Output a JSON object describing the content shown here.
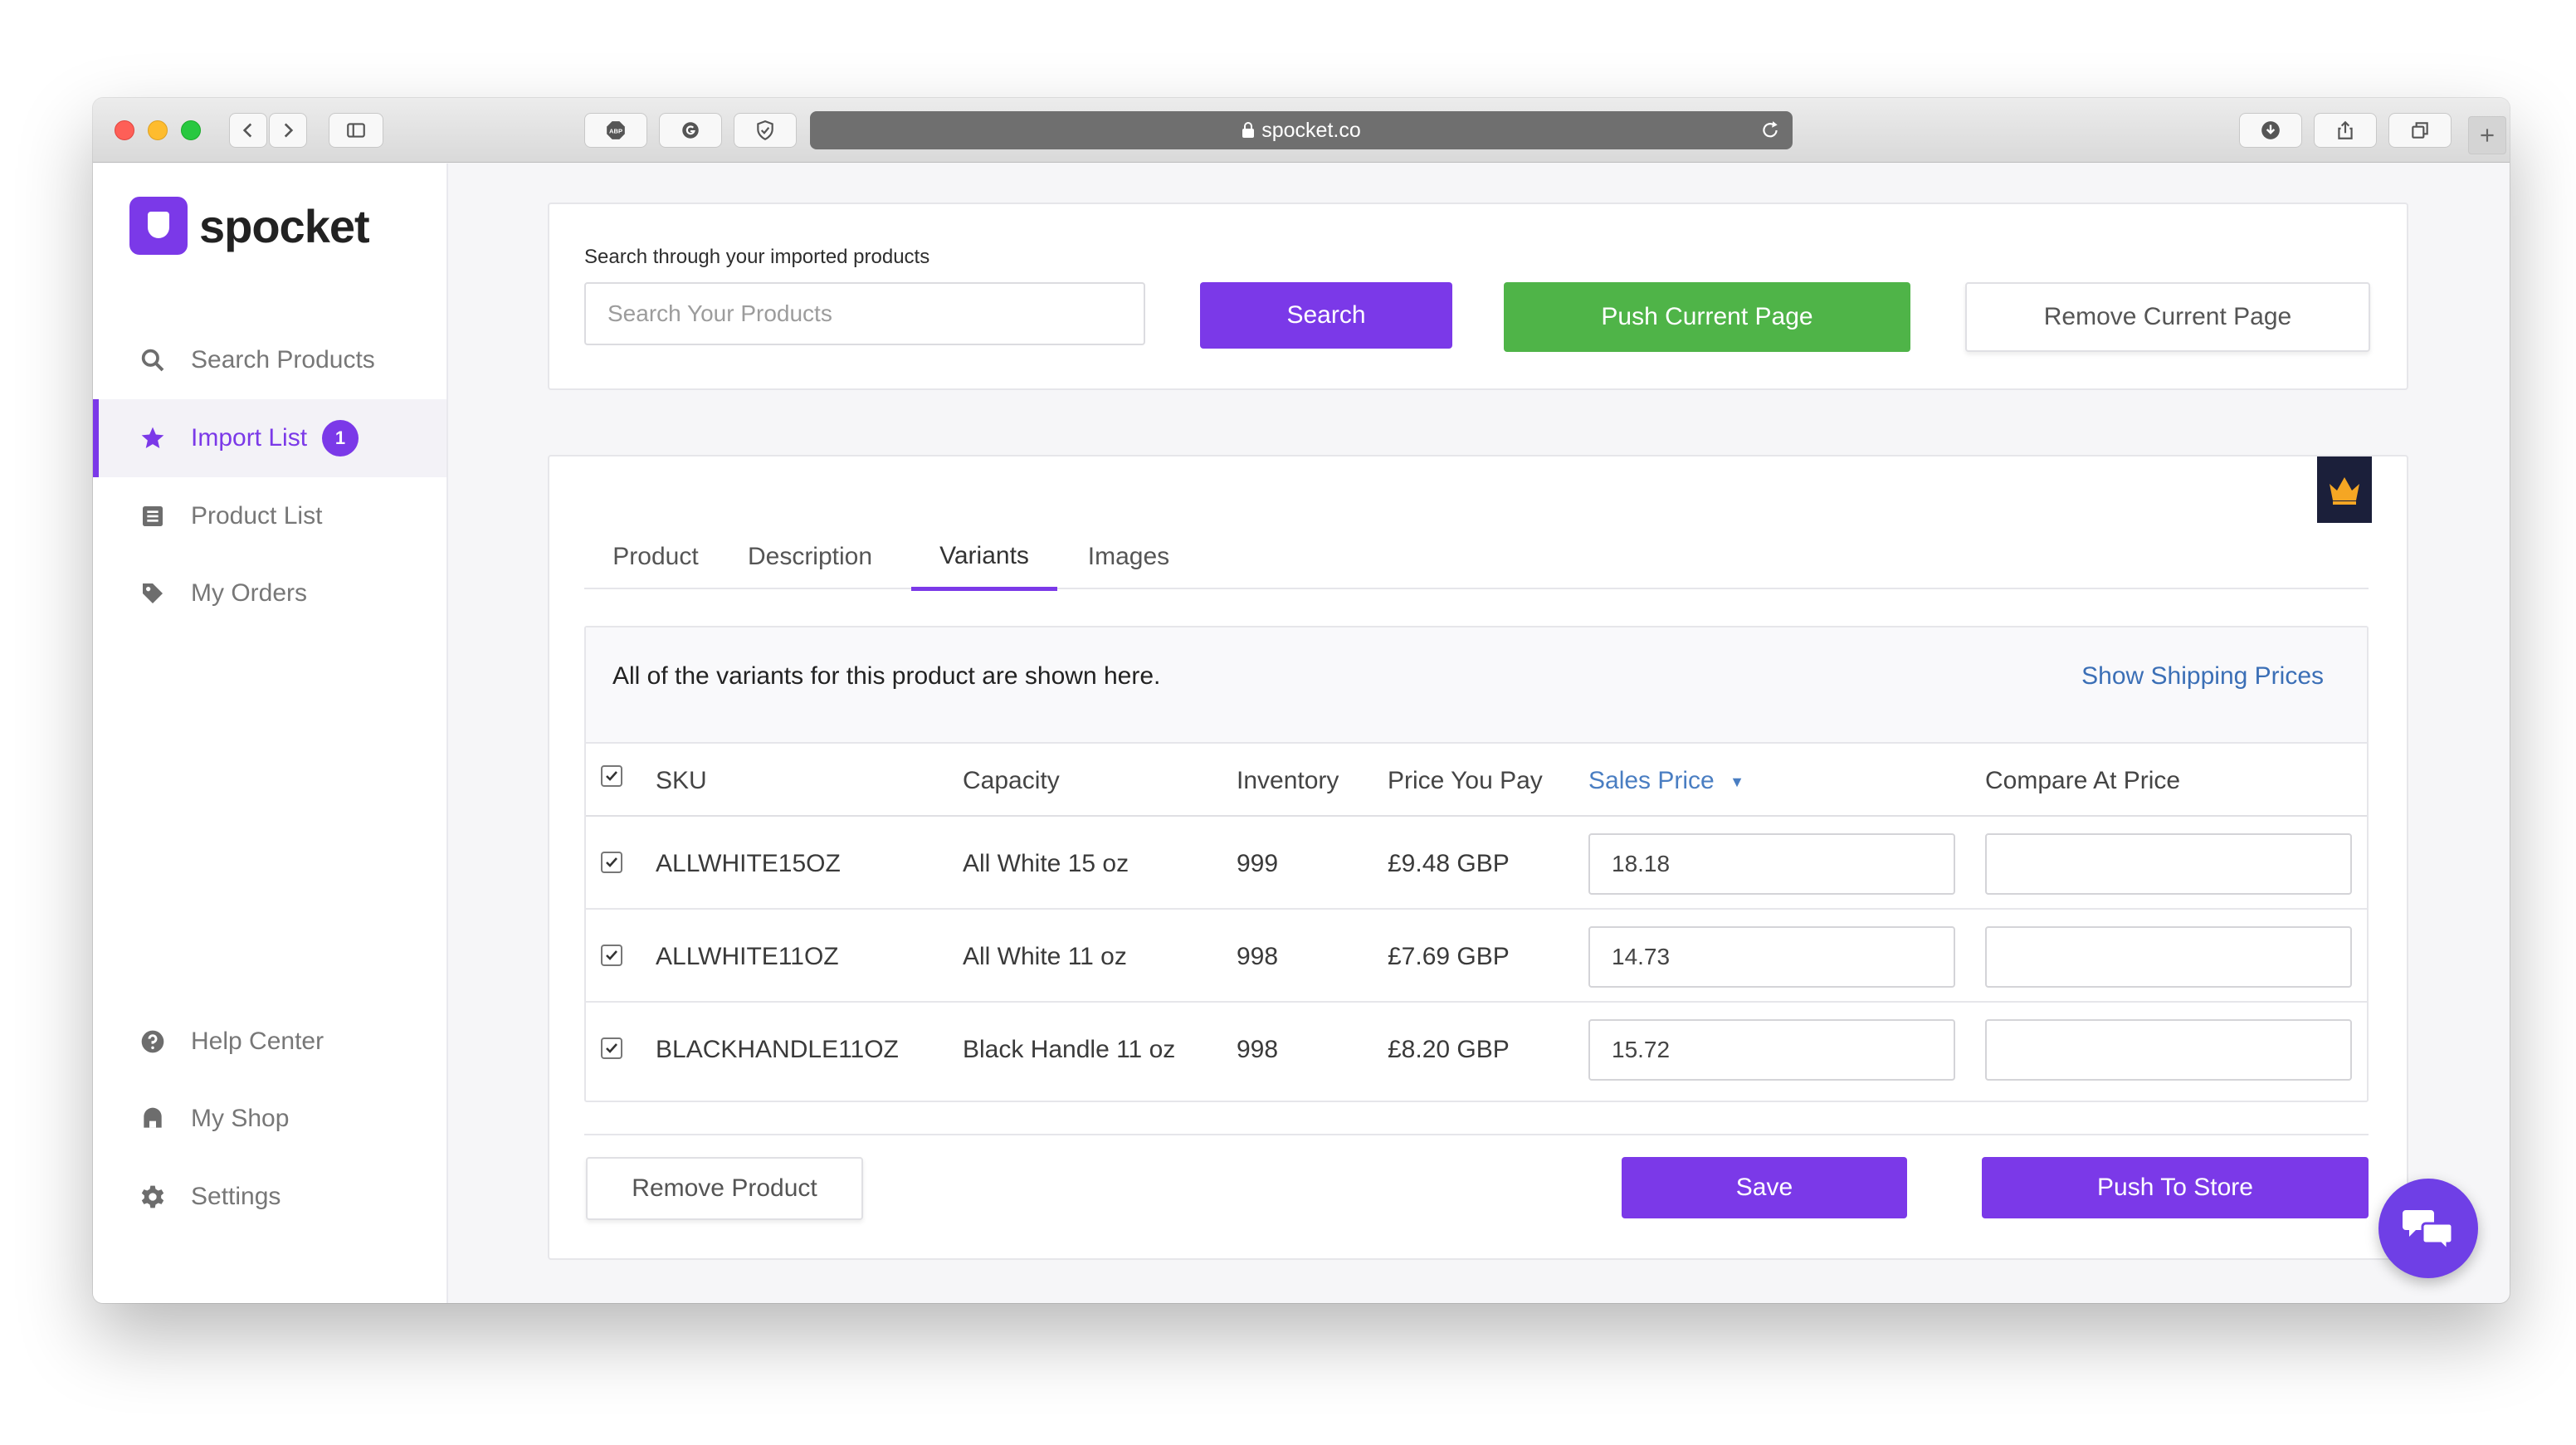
{
  "browser": {
    "url": "spocket.co",
    "toolbar_icons": [
      "back-icon",
      "forward-icon",
      "sidebar-toggle-icon",
      "adblock-icon",
      "grammarly-icon",
      "privacy-shield-icon",
      "download-icon",
      "share-icon",
      "tabs-icon",
      "new-tab-icon"
    ],
    "extension_abp_label": "ABP"
  },
  "brand": {
    "name": "spocket",
    "accent": "#7b39e8"
  },
  "sidebar": {
    "items": [
      {
        "label": "Search Products",
        "icon": "search-icon"
      },
      {
        "label": "Import List",
        "icon": "star-icon",
        "badge": "1",
        "active": true
      },
      {
        "label": "Product List",
        "icon": "list-icon"
      },
      {
        "label": "My Orders",
        "icon": "tag-icon"
      },
      {
        "label": "Help Center",
        "icon": "help-icon"
      },
      {
        "label": "My Shop",
        "icon": "shop-icon"
      },
      {
        "label": "Settings",
        "icon": "gear-icon"
      }
    ]
  },
  "search": {
    "label": "Search through your imported products",
    "placeholder": "Search Your Products",
    "value": "",
    "search_button": "Search",
    "push_page_button": "Push Current Page",
    "remove_page_button": "Remove Current Page"
  },
  "product": {
    "tabs": [
      "Product",
      "Description",
      "Variants",
      "Images"
    ],
    "active_tab": "Variants",
    "premium_icon": "crown-icon",
    "variants_message": "All of the variants for this product are shown here.",
    "shipping_link": "Show Shipping Prices",
    "columns": [
      "SKU",
      "Capacity",
      "Inventory",
      "Price You Pay",
      "Sales Price",
      "Compare At Price"
    ],
    "sort_indicator": "▼",
    "select_all_checked": true,
    "rows": [
      {
        "checked": true,
        "sku": "ALLWHITE15OZ",
        "capacity": "All White 15 oz",
        "inventory": "999",
        "price_you_pay": "£9.48 GBP",
        "sales_price": "18.18",
        "compare_at_price": ""
      },
      {
        "checked": true,
        "sku": "ALLWHITE11OZ",
        "capacity": "All White 11 oz",
        "inventory": "998",
        "price_you_pay": "£7.69 GBP",
        "sales_price": "14.73",
        "compare_at_price": ""
      },
      {
        "checked": true,
        "sku": "BLACKHANDLE11OZ",
        "capacity": "Black Handle 11 oz",
        "inventory": "998",
        "price_you_pay": "£8.20 GBP",
        "sales_price": "15.72",
        "compare_at_price": ""
      }
    ],
    "remove_button": "Remove Product",
    "save_button": "Save",
    "push_button": "Push To Store"
  },
  "chat": {
    "icon": "chat-icon"
  },
  "colors": {
    "purple": "#7b39e8",
    "green": "#4fb448",
    "link": "#3b6fb6",
    "crown_bg": "#1b1f3a",
    "crown": "#f5a623"
  }
}
